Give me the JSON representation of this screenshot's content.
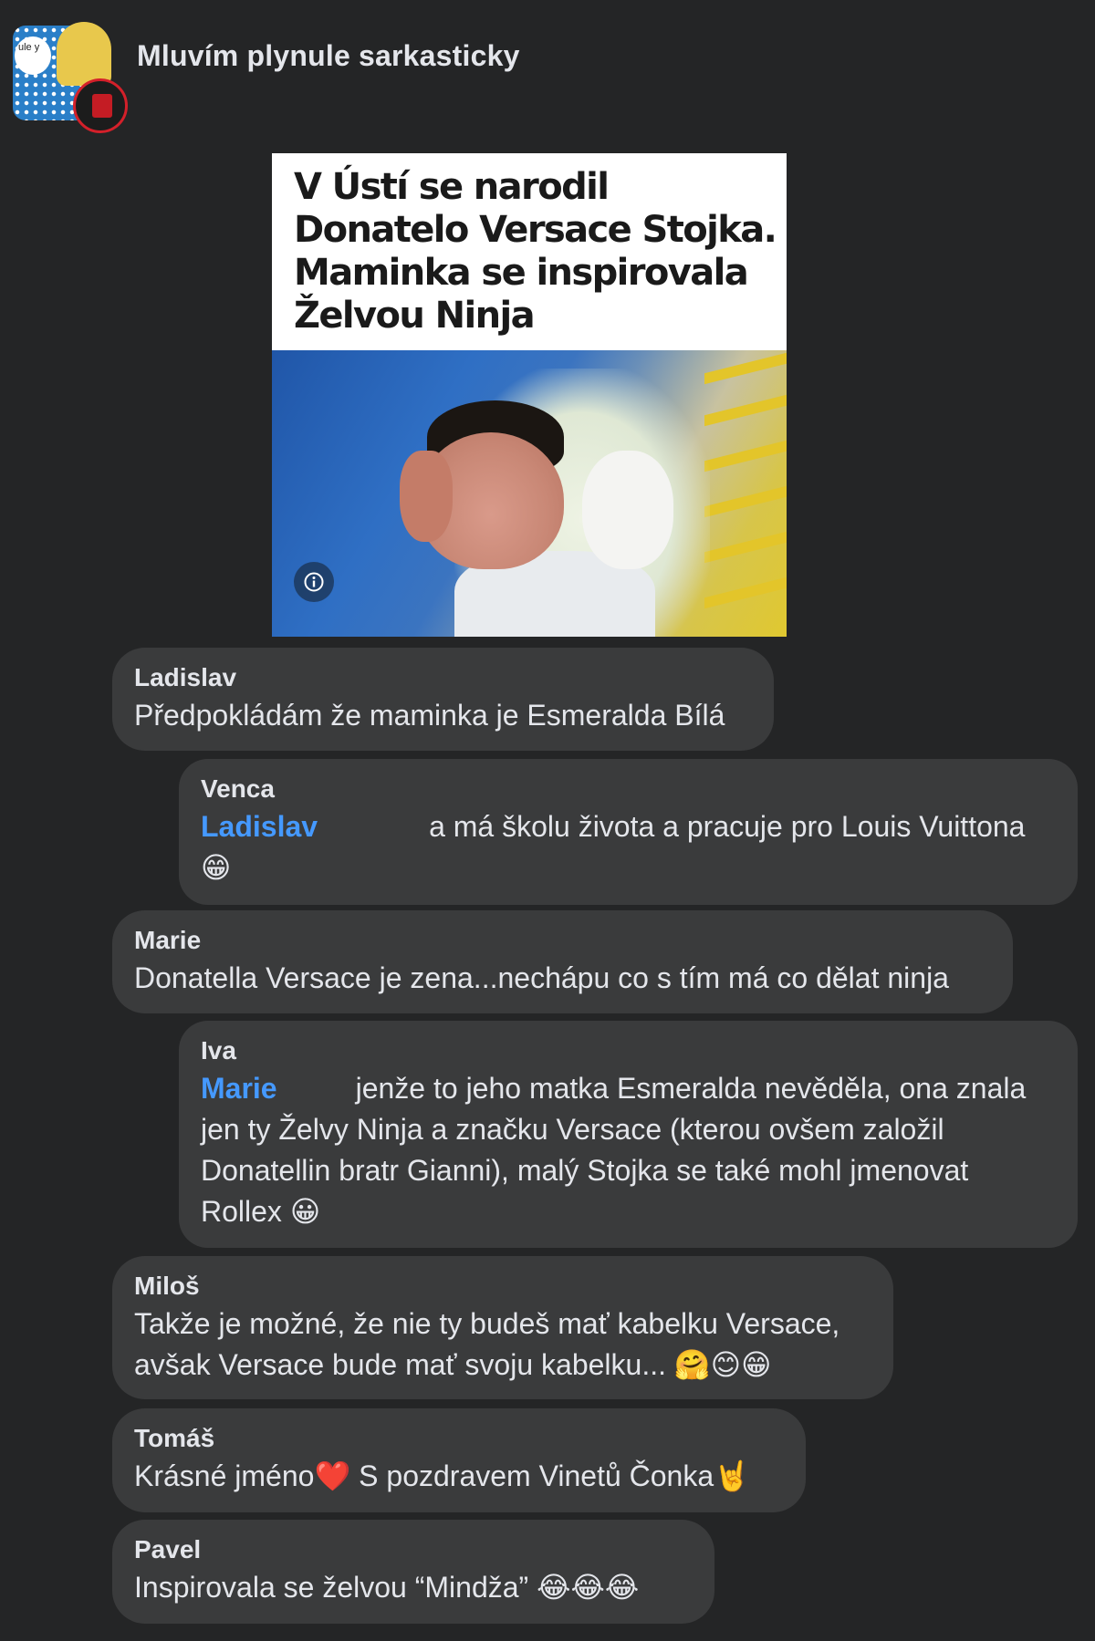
{
  "group": {
    "title": "Mluvím plynule sarkasticky",
    "avatar_bubble_text": "ule y"
  },
  "post": {
    "headline": "V Ústí se narodil Donatelo Versace Stojka. Maminka se inspirovala Želvou Ninja",
    "info_icon": "info-circle-icon"
  },
  "comments": [
    {
      "author": "Ladislav",
      "text": "Předpokládám že maminka je Esmeralda Bílá"
    },
    {
      "author": "Venca",
      "mention": "Ladislav",
      "text": "a má školu života a pracuje pro Louis Vuittona",
      "emoji": "😁"
    },
    {
      "author": "Marie",
      "text": "Donatella Versace je zena...nechápu co s tím má co dělat ninja"
    },
    {
      "author": "Iva",
      "mention": "Marie",
      "text_line1": "jenže to jeho matka Esmeralda nevěděla, ona znala",
      "text_line2": "jen ty Želvy Ninja a značku Versace (kterou ovšem založil",
      "text_line3": "Donatellin bratr Gianni), malý Stojka se také mohl jmenovat",
      "text_line4": "Rollex",
      "emoji": "😀"
    },
    {
      "author": "Miloš",
      "text_line1": "Takže je možné, že nie ty budeš mať kabelku Versace,",
      "text_line2": "avšak Versace bude mať svoju kabelku...",
      "emoji": "🤗😊😁"
    },
    {
      "author": "Tomáš",
      "text_a": "Krásné jméno",
      "emoji_a": "❤️",
      "text_b": " S pozdravem Vinetů Čonka",
      "emoji_b": "🤘"
    },
    {
      "author": "Pavel",
      "text": "Inspirovala se želvou “Mindža”",
      "emoji": "😂😂😂"
    }
  ],
  "colors": {
    "background": "#242526",
    "bubble": "#3a3b3c",
    "text": "#e4e6eb",
    "mention": "#4599ff"
  }
}
